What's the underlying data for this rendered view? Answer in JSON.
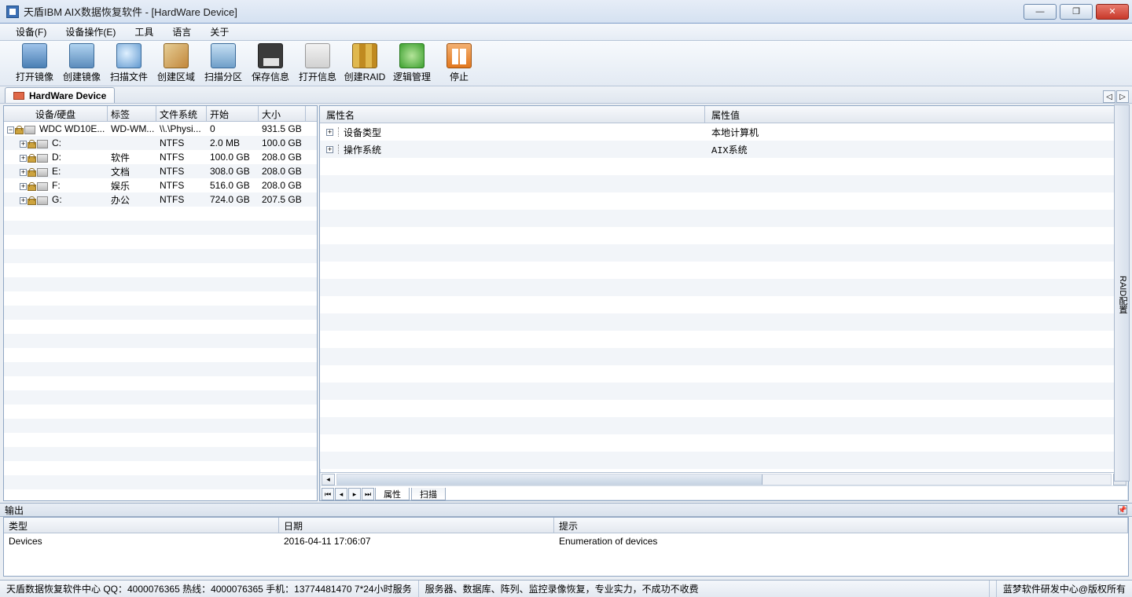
{
  "title": "天盾IBM AIX数据恢复软件 - [HardWare Device]",
  "menu": {
    "device": "设备(F)",
    "deviceOps": "设备操作(E)",
    "tools": "工具",
    "lang": "语言",
    "about": "关于"
  },
  "toolbar": [
    {
      "label": "打开镜像"
    },
    {
      "label": "创建镜像"
    },
    {
      "label": "扫描文件"
    },
    {
      "label": "创建区域"
    },
    {
      "label": "扫描分区"
    },
    {
      "label": "保存信息"
    },
    {
      "label": "打开信息"
    },
    {
      "label": "创建RAID"
    },
    {
      "label": "逻辑管理"
    },
    {
      "label": "停止"
    }
  ],
  "doctab": {
    "label": "HardWare Device"
  },
  "leftGrid": {
    "headers": {
      "dev": "设备/硬盘",
      "tag": "标签",
      "fs": "文件系统",
      "start": "开始",
      "size": "大小"
    },
    "rows": [
      {
        "dev": "WDC WD10E...",
        "tag": "WD-WM...",
        "fs": "\\\\.\\Physi...",
        "start": "0",
        "size": "931.5 GB",
        "depth": 0,
        "expand": "−",
        "isDisk": true
      },
      {
        "dev": "C:",
        "tag": "",
        "fs": "NTFS",
        "start": "2.0 MB",
        "size": "100.0 GB",
        "depth": 1,
        "expand": "+"
      },
      {
        "dev": "D:",
        "tag": "软件",
        "fs": "NTFS",
        "start": "100.0 GB",
        "size": "208.0 GB",
        "depth": 1,
        "expand": "+"
      },
      {
        "dev": "E:",
        "tag": "文档",
        "fs": "NTFS",
        "start": "308.0 GB",
        "size": "208.0 GB",
        "depth": 1,
        "expand": "+"
      },
      {
        "dev": "F:",
        "tag": "娱乐",
        "fs": "NTFS",
        "start": "516.0 GB",
        "size": "208.0 GB",
        "depth": 1,
        "expand": "+"
      },
      {
        "dev": "G:",
        "tag": "办公",
        "fs": "NTFS",
        "start": "724.0 GB",
        "size": "207.5 GB",
        "depth": 1,
        "expand": "+"
      }
    ]
  },
  "props": {
    "headName": "属性名",
    "headVal": "属性值",
    "rows": [
      {
        "k": "设备类型",
        "v": "本地计算机"
      },
      {
        "k": "操作系统",
        "v": "AIX系统"
      }
    ]
  },
  "bottomTabs": {
    "attr": "属性",
    "scan": "扫描"
  },
  "sideStub": "RAID配置",
  "outputTitle": "输出",
  "outputHeaders": {
    "type": "类型",
    "date": "日期",
    "hint": "提示"
  },
  "outputRows": [
    {
      "type": "Devices",
      "date": "2016-04-11 17:06:07",
      "hint": "Enumeration of devices"
    }
  ],
  "statusL": "天盾数据恢复软件中心 QQ：4000076365 热线：4000076365 手机：13774481470  7*24小时服务",
  "statusM": "服务器、数据库、阵列、监控录像恢复，专业实力，不成功不收费",
  "statusR": "蓝梦软件研发中心@版权所有"
}
